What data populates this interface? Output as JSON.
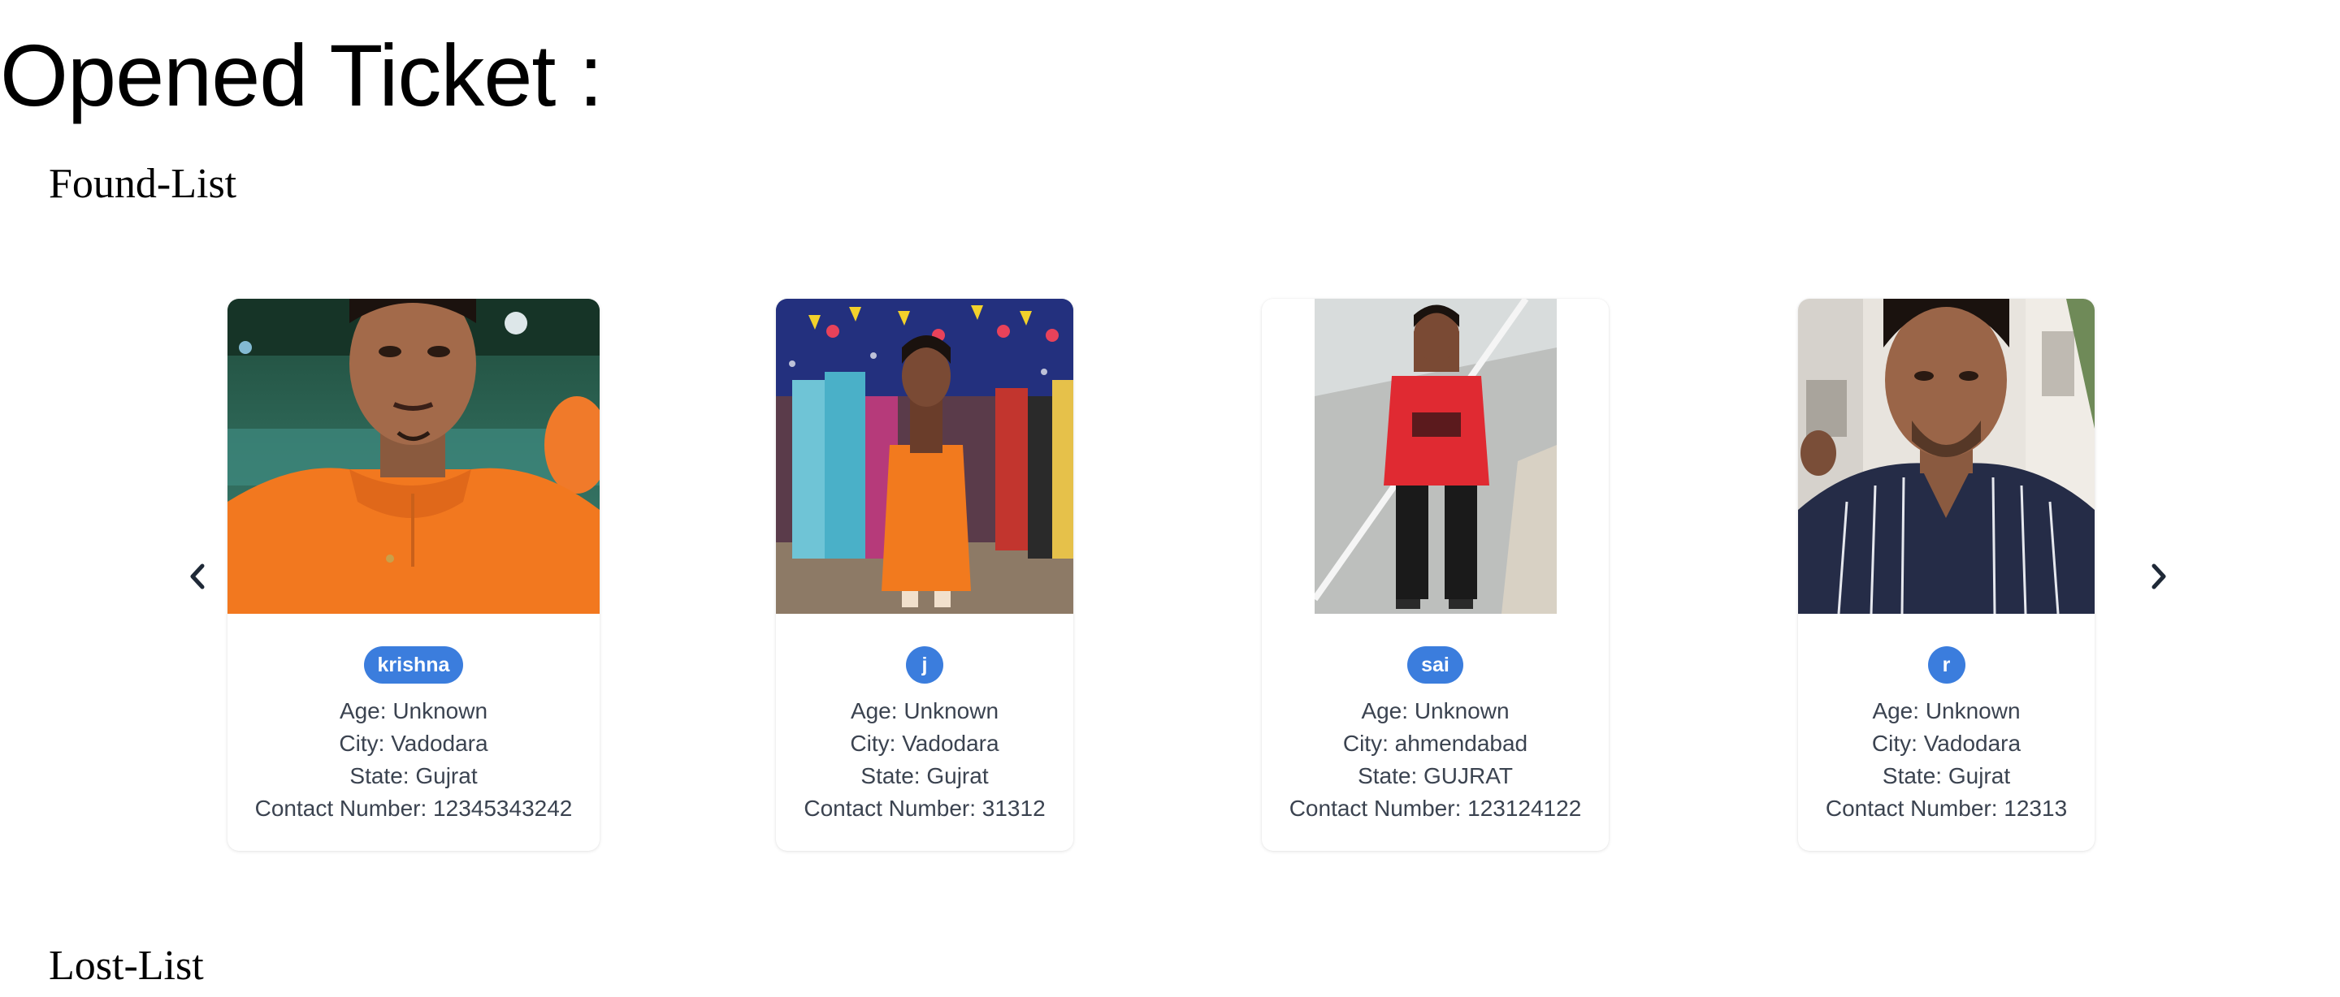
{
  "page": {
    "title": "Opened Ticket :",
    "found_heading": "Found-List",
    "lost_heading": "Lost-List"
  },
  "carousel": {
    "prev_icon": "chevron-left-icon",
    "next_icon": "chevron-right-icon",
    "cards": [
      {
        "name": "krishna",
        "age": "Age: Unknown",
        "city": "City: Vadodara",
        "state": "State: Gujrat",
        "contact": "Contact Number: 12345343242",
        "photo": "person-photo-orange-kurta-selfie"
      },
      {
        "name": "j",
        "age": "Age: Unknown",
        "city": "City: Vadodara",
        "state": "State: Gujrat",
        "contact": "Contact Number: 31312",
        "photo": "person-photo-orange-kurta-festival"
      },
      {
        "name": "sai",
        "age": "Age: Unknown",
        "city": "City: ahmendabad",
        "state": "State: GUJRAT",
        "contact": "Contact Number: 123124122",
        "photo": "person-photo-red-shirt-road"
      },
      {
        "name": "r",
        "age": "Age: Unknown",
        "city": "City: Vadodara",
        "state": "State: Gujrat",
        "contact": "Contact Number: 12313",
        "photo": "person-photo-striped-shirt-selfie"
      }
    ]
  },
  "colors": {
    "badge": "#3b7ddd",
    "info_text": "#3b4350",
    "arrow": "#1f2937"
  }
}
